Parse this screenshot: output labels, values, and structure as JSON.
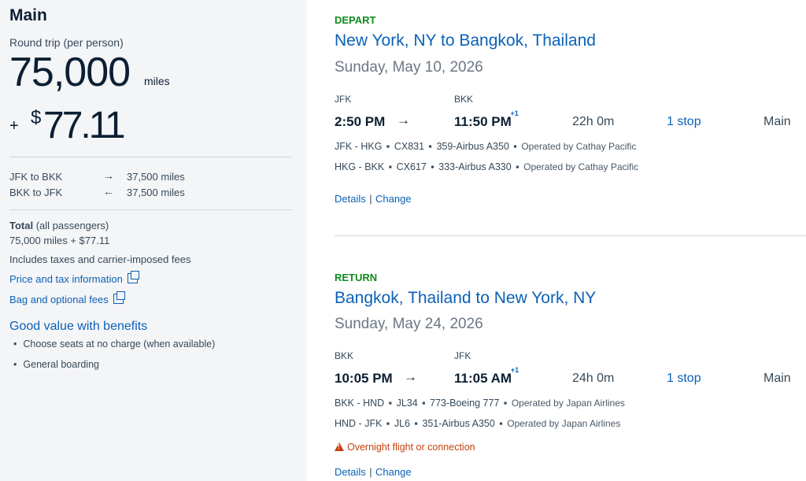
{
  "summary": {
    "cabin_title": "Main",
    "round_trip_label": "Round trip (per person)",
    "miles_amount": "75,000",
    "miles_unit": "miles",
    "plus": "+",
    "dollar_sign": "$",
    "cash_amount": "77.11",
    "segments": [
      {
        "route": "JFK to BKK",
        "arrow": "→",
        "miles": "37,500 miles"
      },
      {
        "route": "BKK to JFK",
        "arrow": "←",
        "miles": "37,500 miles"
      }
    ],
    "total_label": "Total",
    "total_qualifier": "(all passengers)",
    "total_value": "75,000 miles + $77.11",
    "includes_note": "Includes taxes and carrier-imposed fees",
    "price_tax_link": "Price and tax information",
    "bag_fees_link": "Bag and optional fees",
    "benefits_title": "Good value with benefits",
    "benefits": [
      "Choose seats at no charge (when available)",
      "General boarding"
    ]
  },
  "depart": {
    "label": "DEPART",
    "route": "New York, NY to Bangkok, Thailand",
    "date": "Sunday, May 10, 2026",
    "origin": "JFK",
    "destination": "BKK",
    "depart_time": "2:50 PM",
    "arrow": "→",
    "arrive_time": "11:50 PM",
    "day_offset": "+1",
    "duration": "22h 0m",
    "stops": "1 stop",
    "cabin": "Main",
    "segments": [
      {
        "route": "JFK - HKG",
        "flight": "CX831",
        "aircraft": "359-Airbus A350",
        "operated": "Operated by Cathay Pacific"
      },
      {
        "route": "HKG - BKK",
        "flight": "CX617",
        "aircraft": "333-Airbus A330",
        "operated": "Operated by Cathay Pacific"
      }
    ],
    "details_link": "Details",
    "change_link": "Change"
  },
  "return": {
    "label": "RETURN",
    "route": "Bangkok, Thailand to New York, NY",
    "date": "Sunday, May 24, 2026",
    "origin": "BKK",
    "destination": "JFK",
    "depart_time": "10:05 PM",
    "arrow": "→",
    "arrive_time": "11:05 AM",
    "day_offset": "+1",
    "duration": "24h 0m",
    "stops": "1 stop",
    "cabin": "Main",
    "segments": [
      {
        "route": "BKK - HND",
        "flight": "JL34",
        "aircraft": "773-Boeing 777",
        "operated": "Operated by Japan Airlines"
      },
      {
        "route": "HND - JFK",
        "flight": "JL6",
        "aircraft": "351-Airbus A350",
        "operated": "Operated by Japan Airlines"
      }
    ],
    "warning": "Overnight flight or connection",
    "details_link": "Details",
    "change_link": "Change"
  },
  "separators": {
    "dot": "▪",
    "pipe": "|"
  },
  "colors": {
    "link": "#0b61b8",
    "section_label": "#0f8a1e",
    "warning": "#c3410f",
    "panel_bg": "#f4f5f7"
  },
  "icons": {
    "external_link": "external-link-icon",
    "warning": "warning-triangle-icon"
  }
}
